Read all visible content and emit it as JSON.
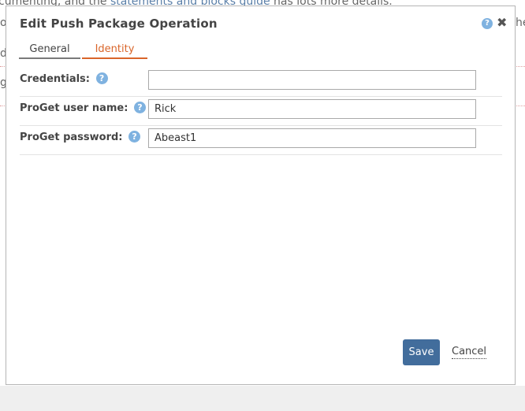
{
  "background": {
    "line1_prefix": "cumenting, and the ",
    "line1_link": "statements and blocks guide",
    "line1_suffix": " has lots more details.",
    "frag_left_1": "o",
    "frag_left_2": "d",
    "frag_left_3": "g",
    "frag_right": "he"
  },
  "dialog": {
    "title": "Edit Push Package Operation",
    "help_glyph": "?",
    "close_glyph": "✖"
  },
  "tabs": [
    {
      "label": "General",
      "active": false
    },
    {
      "label": "Identity",
      "active": true
    }
  ],
  "form": {
    "credentials": {
      "label": "Credentials:",
      "value": ""
    },
    "username": {
      "label": "ProGet user name:",
      "value": "Rick"
    },
    "password": {
      "label": "ProGet password:",
      "value": "Abeast1"
    }
  },
  "buttons": {
    "save_label": "Save",
    "cancel_label": "Cancel"
  },
  "colors": {
    "accent": "#d9652a",
    "primary_button": "#426d9c",
    "help_icon": "#7fb2e0"
  },
  "icons": {
    "help": "help-icon",
    "close": "close-icon"
  }
}
